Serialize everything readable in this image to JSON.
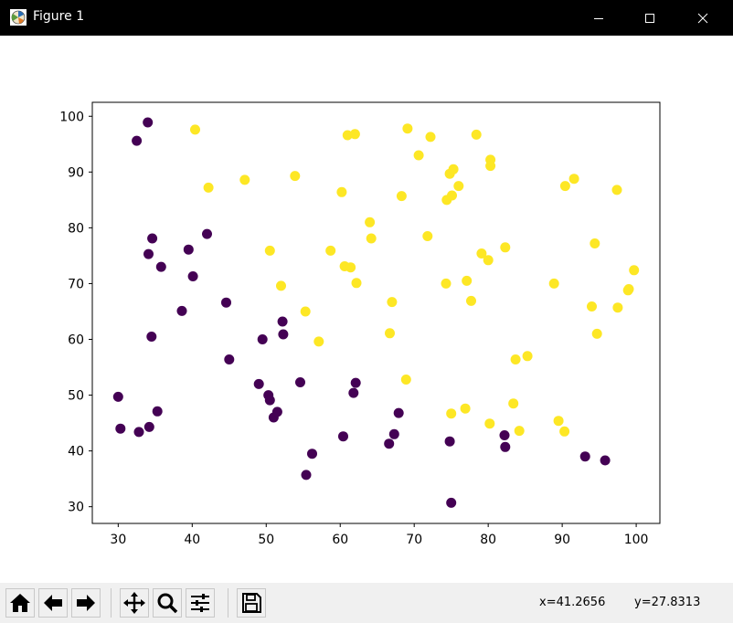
{
  "window": {
    "title": "Figure 1",
    "icons": [
      "matplotlib-figure-icon",
      "minimize-icon",
      "maximize-icon",
      "close-icon"
    ]
  },
  "toolbar": {
    "buttons": [
      "home-icon",
      "back-icon",
      "forward-icon",
      "pan-icon",
      "zoom-icon",
      "configure-subplots-icon",
      "save-icon"
    ],
    "x_readout": "x=41.2656",
    "y_readout": "y=27.8313"
  },
  "chart_data": {
    "type": "scatter",
    "x_ticks": [
      "30",
      "40",
      "50",
      "60",
      "70",
      "80",
      "90",
      "100"
    ],
    "y_ticks": [
      "30",
      "40",
      "50",
      "60",
      "70",
      "80",
      "90",
      "100"
    ],
    "xlim": [
      26.5,
      103.2
    ],
    "ylim": [
      27.0,
      102.5
    ],
    "grid": false,
    "colors": {
      "class_0": "#440154",
      "class_1": "#fde725"
    },
    "series": [
      {
        "class": 0,
        "x": [
          34.0,
          32.5,
          34.6,
          34.1,
          35.8,
          39.5,
          42.0,
          40.1,
          38.6,
          34.5,
          44.6,
          45.0,
          30.0,
          30.3,
          32.8,
          34.2,
          35.3,
          49.5,
          52.2,
          52.3,
          49.0,
          50.3,
          50.5,
          51.0,
          51.5,
          54.6,
          56.2,
          55.4,
          60.4,
          61.8,
          62.1,
          67.9,
          67.3,
          66.6,
          74.8,
          75.0,
          82.2,
          82.3,
          93.1,
          95.8
        ],
        "y": [
          98.9,
          95.6,
          78.1,
          75.3,
          73.0,
          76.1,
          78.9,
          71.3,
          65.1,
          60.5,
          66.6,
          56.4,
          49.7,
          44.0,
          43.4,
          44.3,
          47.1,
          60.0,
          63.2,
          60.9,
          52.0,
          50.0,
          49.1,
          46.0,
          47.0,
          52.3,
          39.5,
          35.7,
          42.6,
          50.4,
          52.2,
          46.8,
          43.0,
          41.3,
          41.7,
          30.7,
          42.8,
          40.7,
          39.0,
          38.3
        ]
      },
      {
        "class": 1,
        "x": [
          40.4,
          42.2,
          47.1,
          53.9,
          50.5,
          52.0,
          55.3,
          57.1,
          58.7,
          60.2,
          60.6,
          61.4,
          62.2,
          64.0,
          64.2,
          61.0,
          62.0,
          69.1,
          72.2,
          70.6,
          68.3,
          71.8,
          66.7,
          67.0,
          68.9,
          74.8,
          75.3,
          76.0,
          74.4,
          75.1,
          74.3,
          79.1,
          78.4,
          80.3,
          80.3,
          80.0,
          77.1,
          77.7,
          82.3,
          83.4,
          83.7,
          85.3,
          84.2,
          80.2,
          76.9,
          75.0,
          89.5,
          90.3,
          90.4,
          91.6,
          88.9,
          94.0,
          94.4,
          97.5,
          97.4,
          99.0,
          99.7,
          98.9,
          94.7
        ],
        "y": [
          97.6,
          87.2,
          88.6,
          89.3,
          75.9,
          69.6,
          65.0,
          59.6,
          75.9,
          86.4,
          73.1,
          72.9,
          70.1,
          81.0,
          78.1,
          96.6,
          96.8,
          97.8,
          96.3,
          93.0,
          85.7,
          78.5,
          61.1,
          66.7,
          52.8,
          89.7,
          90.5,
          87.5,
          85.0,
          85.8,
          70.0,
          75.4,
          96.7,
          92.2,
          91.1,
          74.2,
          70.5,
          66.9,
          76.5,
          48.5,
          56.4,
          57.0,
          43.6,
          44.9,
          47.6,
          46.7,
          45.4,
          43.5,
          87.5,
          88.8,
          70.0,
          65.9,
          77.2,
          65.7,
          86.8,
          69.0,
          72.4,
          68.8,
          61.0
        ]
      }
    ]
  }
}
